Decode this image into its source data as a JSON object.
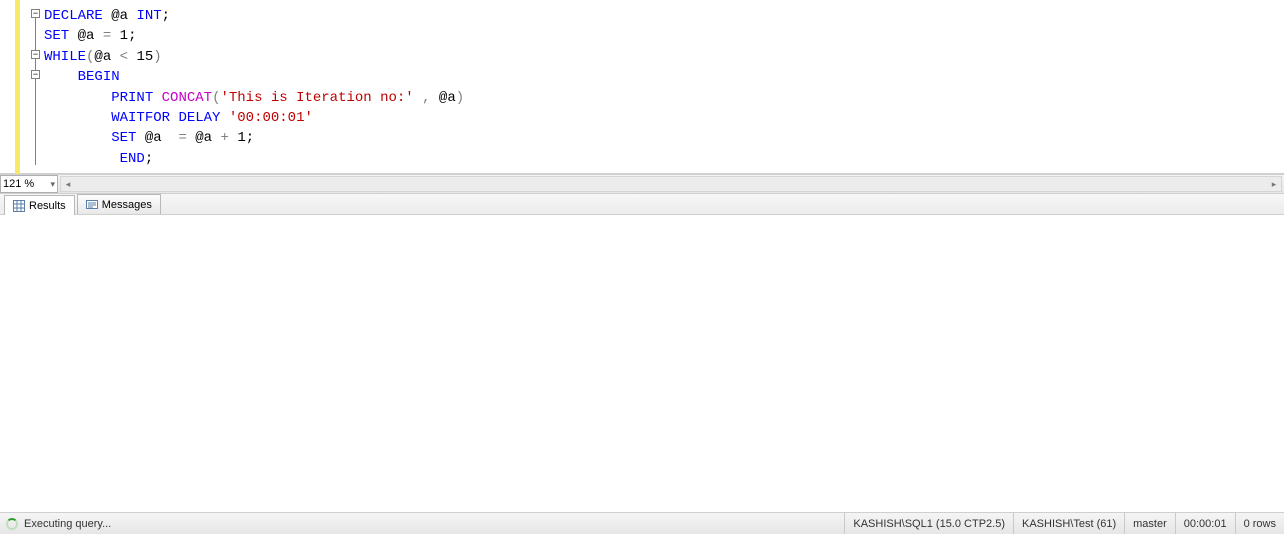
{
  "editor": {
    "zoom": "121 %",
    "lines": [
      {
        "indent": 0,
        "tokens": [
          {
            "t": "kw",
            "v": "DECLARE"
          },
          {
            "t": "sp",
            "v": " "
          },
          {
            "t": "var",
            "v": "@a"
          },
          {
            "t": "sp",
            "v": " "
          },
          {
            "t": "kw",
            "v": "INT"
          },
          {
            "t": "semi",
            "v": ";"
          }
        ]
      },
      {
        "indent": 0,
        "tokens": [
          {
            "t": "kw",
            "v": "SET"
          },
          {
            "t": "sp",
            "v": " "
          },
          {
            "t": "var",
            "v": "@a"
          },
          {
            "t": "sp",
            "v": " "
          },
          {
            "t": "op",
            "v": "="
          },
          {
            "t": "sp",
            "v": " "
          },
          {
            "t": "num",
            "v": "1"
          },
          {
            "t": "semi",
            "v": ";"
          }
        ]
      },
      {
        "indent": 0,
        "tokens": [
          {
            "t": "kw",
            "v": "WHILE"
          },
          {
            "t": "op",
            "v": "("
          },
          {
            "t": "var",
            "v": "@a"
          },
          {
            "t": "sp",
            "v": " "
          },
          {
            "t": "op",
            "v": "<"
          },
          {
            "t": "sp",
            "v": " "
          },
          {
            "t": "num",
            "v": "15"
          },
          {
            "t": "op",
            "v": ")"
          }
        ]
      },
      {
        "indent": 4,
        "tokens": [
          {
            "t": "kw",
            "v": "BEGIN"
          }
        ]
      },
      {
        "indent": 8,
        "tokens": [
          {
            "t": "kw",
            "v": "PRINT"
          },
          {
            "t": "sp",
            "v": " "
          },
          {
            "t": "func",
            "v": "CONCAT"
          },
          {
            "t": "op",
            "v": "("
          },
          {
            "t": "str",
            "v": "'This is Iteration no:'"
          },
          {
            "t": "sp",
            "v": " "
          },
          {
            "t": "op",
            "v": ","
          },
          {
            "t": "sp",
            "v": " "
          },
          {
            "t": "var",
            "v": "@a"
          },
          {
            "t": "op",
            "v": ")"
          }
        ]
      },
      {
        "indent": 8,
        "tokens": [
          {
            "t": "kw",
            "v": "WAITFOR"
          },
          {
            "t": "sp",
            "v": " "
          },
          {
            "t": "kw",
            "v": "DELAY"
          },
          {
            "t": "sp",
            "v": " "
          },
          {
            "t": "str",
            "v": "'00:00:01'"
          }
        ]
      },
      {
        "indent": 8,
        "tokens": [
          {
            "t": "kw",
            "v": "SET"
          },
          {
            "t": "sp",
            "v": " "
          },
          {
            "t": "var",
            "v": "@a"
          },
          {
            "t": "sp",
            "v": "  "
          },
          {
            "t": "op",
            "v": "="
          },
          {
            "t": "sp",
            "v": " "
          },
          {
            "t": "var",
            "v": "@a"
          },
          {
            "t": "sp",
            "v": " "
          },
          {
            "t": "op",
            "v": "+"
          },
          {
            "t": "sp",
            "v": " "
          },
          {
            "t": "num",
            "v": "1"
          },
          {
            "t": "semi",
            "v": ";"
          }
        ]
      },
      {
        "indent": 9,
        "tokens": [
          {
            "t": "kw",
            "v": "END"
          },
          {
            "t": "semi",
            "v": ";"
          }
        ]
      }
    ],
    "fold_markers": [
      {
        "line": 0,
        "symbol": "−"
      },
      {
        "line": 2,
        "symbol": "−"
      },
      {
        "line": 3,
        "symbol": "−"
      }
    ]
  },
  "tabs": {
    "results": "Results",
    "messages": "Messages"
  },
  "status": {
    "message": "Executing query...",
    "server": "KASHISH\\SQL1 (15.0 CTP2.5)",
    "login": "KASHISH\\Test (61)",
    "database": "master",
    "elapsed": "00:00:01",
    "rows": "0 rows"
  }
}
